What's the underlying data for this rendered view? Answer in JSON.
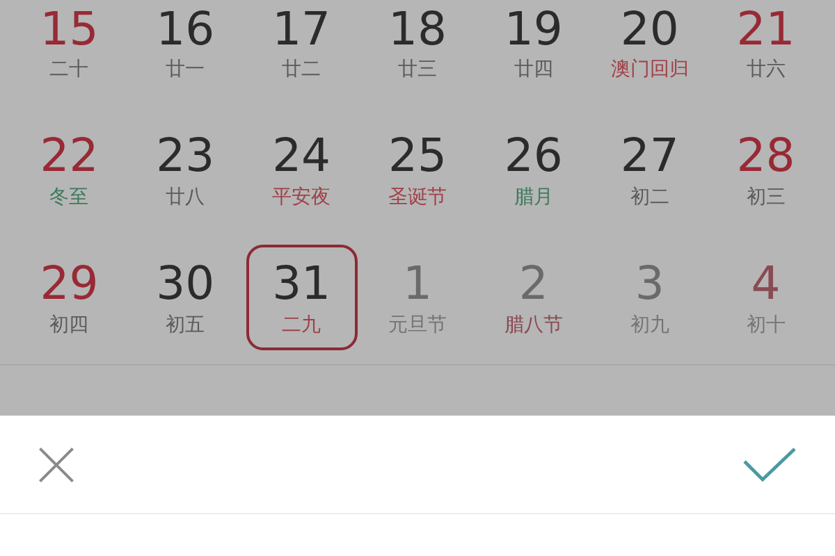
{
  "calendar": {
    "weeks": [
      {
        "days": [
          {
            "day": "15",
            "lunar": "二十",
            "weekend": true,
            "other_month": false,
            "selected": false,
            "color": "#5a5a5a"
          },
          {
            "day": "16",
            "lunar": "廿一",
            "weekend": false,
            "other_month": false,
            "selected": false,
            "color": "#5a5a5a"
          },
          {
            "day": "17",
            "lunar": "廿二",
            "weekend": false,
            "other_month": false,
            "selected": false,
            "color": "#5a5a5a"
          },
          {
            "day": "18",
            "lunar": "廿三",
            "weekend": false,
            "other_month": false,
            "selected": false,
            "color": "#5a5a5a"
          },
          {
            "day": "19",
            "lunar": "廿四",
            "weekend": false,
            "other_month": false,
            "selected": false,
            "color": "#5a5a5a"
          },
          {
            "day": "20",
            "lunar": "澳门回归",
            "weekend": false,
            "other_month": false,
            "selected": false,
            "color": "#a04048"
          },
          {
            "day": "21",
            "lunar": "廿六",
            "weekend": true,
            "other_month": false,
            "selected": false,
            "color": "#5a5a5a"
          }
        ]
      },
      {
        "days": [
          {
            "day": "22",
            "lunar": "冬至",
            "weekend": true,
            "other_month": false,
            "selected": false,
            "color": "#3f7a5c"
          },
          {
            "day": "23",
            "lunar": "廿八",
            "weekend": false,
            "other_month": false,
            "selected": false,
            "color": "#5a5a5a"
          },
          {
            "day": "24",
            "lunar": "平安夜",
            "weekend": false,
            "other_month": false,
            "selected": false,
            "color": "#a04048"
          },
          {
            "day": "25",
            "lunar": "圣诞节",
            "weekend": false,
            "other_month": false,
            "selected": false,
            "color": "#a04048"
          },
          {
            "day": "26",
            "lunar": "腊月",
            "weekend": false,
            "other_month": false,
            "selected": false,
            "color": "#3f7a5c"
          },
          {
            "day": "27",
            "lunar": "初二",
            "weekend": false,
            "other_month": false,
            "selected": false,
            "color": "#5a5a5a"
          },
          {
            "day": "28",
            "lunar": "初三",
            "weekend": true,
            "other_month": false,
            "selected": false,
            "color": "#5a5a5a"
          }
        ]
      },
      {
        "days": [
          {
            "day": "29",
            "lunar": "初四",
            "weekend": true,
            "other_month": false,
            "selected": false,
            "color": "#5a5a5a"
          },
          {
            "day": "30",
            "lunar": "初五",
            "weekend": false,
            "other_month": false,
            "selected": false,
            "color": "#5a5a5a"
          },
          {
            "day": "31",
            "lunar": "二九",
            "weekend": false,
            "other_month": false,
            "selected": true,
            "color": "#a04048"
          },
          {
            "day": "1",
            "lunar": "元旦节",
            "weekend": false,
            "other_month": true,
            "selected": false,
            "color": "#747474"
          },
          {
            "day": "2",
            "lunar": "腊八节",
            "weekend": false,
            "other_month": true,
            "selected": false,
            "color": "#8a4a52"
          },
          {
            "day": "3",
            "lunar": "初九",
            "weekend": false,
            "other_month": true,
            "selected": false,
            "color": "#747474"
          },
          {
            "day": "4",
            "lunar": "初十",
            "weekend": true,
            "other_month": true,
            "selected": false,
            "color": "#747474"
          }
        ]
      }
    ]
  },
  "sheet": {
    "cancel": {
      "kind": "close"
    },
    "confirm": {
      "kind": "check"
    }
  }
}
